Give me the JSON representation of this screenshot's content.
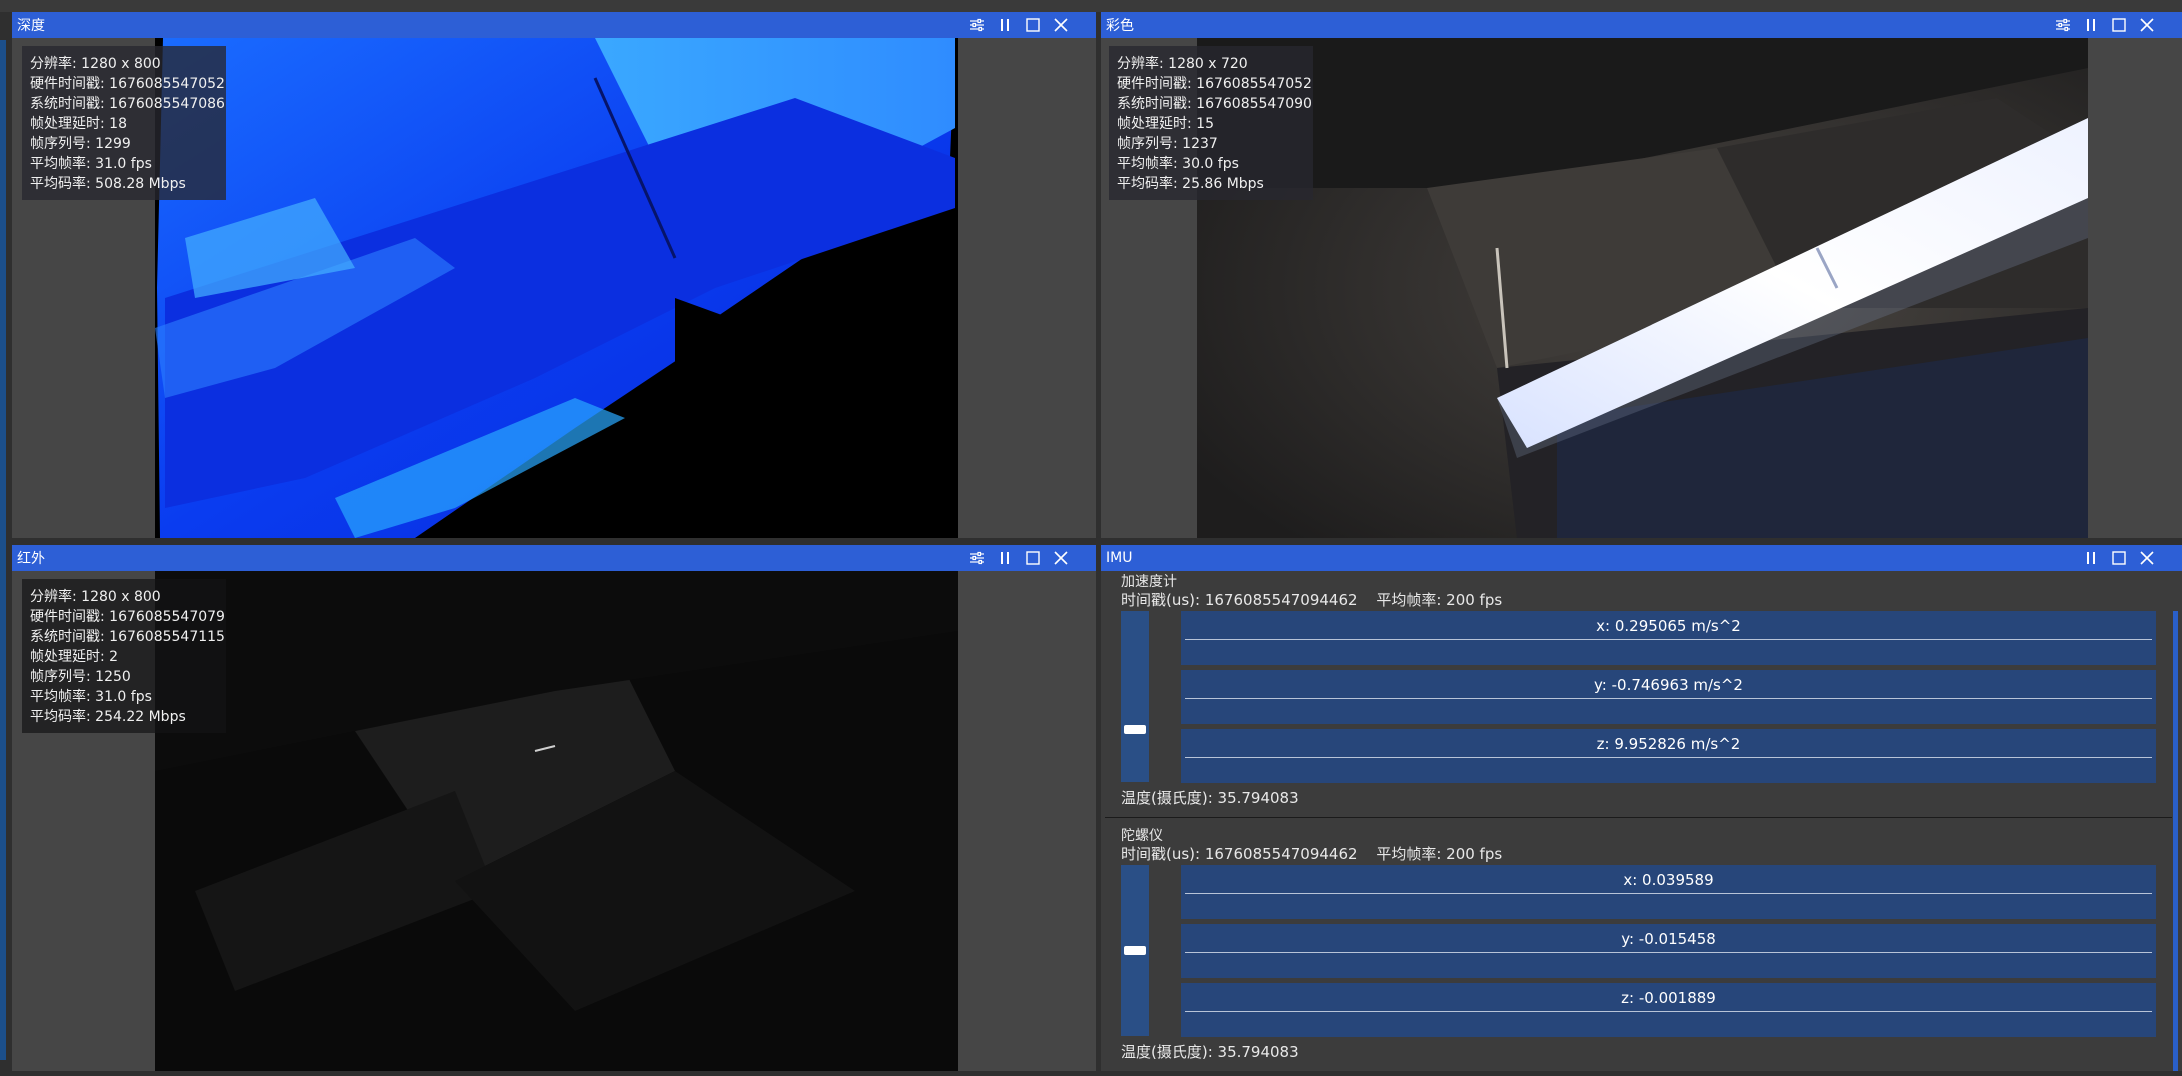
{
  "panels": {
    "depth": {
      "title": "深度",
      "stats": [
        "分辨率: 1280 x 800",
        "硬件时间戳: 1676085547052",
        "系统时间戳: 1676085547086",
        "帧处理延时: 18",
        "帧序列号: 1299",
        "平均帧率: 31.0 fps",
        "平均码率: 508.28 Mbps"
      ]
    },
    "color": {
      "title": "彩色",
      "stats": [
        "分辨率: 1280 x 720",
        "硬件时间戳: 1676085547052",
        "系统时间戳: 1676085547090",
        "帧处理延时: 15",
        "帧序列号: 1237",
        "平均帧率: 30.0 fps",
        "平均码率: 25.86 Mbps"
      ]
    },
    "ir": {
      "title": "红外",
      "stats": [
        "分辨率: 1280 x 800",
        "硬件时间戳: 1676085547079",
        "系统时间戳: 1676085547115",
        "帧处理延时: 2",
        "帧序列号: 1250",
        "平均帧率: 31.0 fps",
        "平均码率: 254.22 Mbps"
      ]
    },
    "imu": {
      "title": "IMU",
      "accel": {
        "title": "加速度计",
        "timestamp": "时间戳(us): 1676085547094462",
        "fps": "平均帧率: 200 fps",
        "x": "x: 0.295065 m/s^2",
        "y": "y: -0.746963 m/s^2",
        "z": "z: 9.952826 m/s^2",
        "temp": "温度(摄氏度): 35.794083"
      },
      "gyro": {
        "title": "陀螺仪",
        "timestamp": "时间戳(us): 1676085547094462",
        "fps": "平均帧率: 200 fps",
        "x": "x: 0.039589",
        "y": "y: -0.015458",
        "z": "z: -0.001889",
        "temp": "温度(摄氏度): 35.794083"
      }
    }
  },
  "icons": {
    "settings": "sliders-icon",
    "pause": "pause-icon",
    "maximize": "maximize-icon",
    "close": "close-icon"
  },
  "colors": {
    "header": "#2d5fd6",
    "panel_bg": "#464646",
    "bar_bg": "#27467a"
  }
}
